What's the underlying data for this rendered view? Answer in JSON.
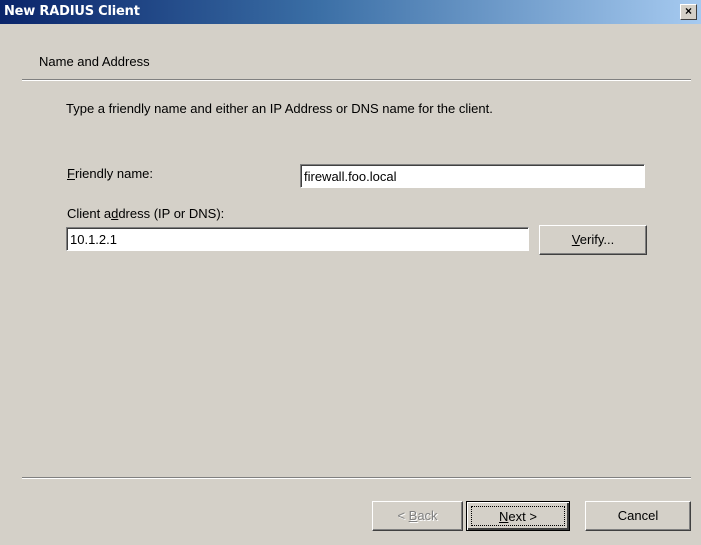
{
  "window": {
    "title": "New RADIUS Client",
    "close_glyph": "×"
  },
  "header": {
    "label": "Name and Address"
  },
  "main": {
    "instruction": "Type a friendly name and either an IP Address or DNS name for the client.",
    "friendly_name": {
      "label_mnemonic": "F",
      "label_rest": "riendly name:",
      "value": "firewall.foo.local"
    },
    "client_address": {
      "label_before": "Client a",
      "label_mnemonic": "d",
      "label_after": "dress (IP or DNS):",
      "value": "10.1.2.1"
    },
    "verify_button": {
      "mnemonic": "V",
      "rest": "erify..."
    }
  },
  "footer": {
    "back": {
      "prefix": "< ",
      "mnemonic": "B",
      "rest": "ack"
    },
    "next": {
      "mnemonic": "N",
      "rest": "ext >"
    },
    "cancel": "Cancel"
  },
  "colors": {
    "titlebar_start": "#0a246a",
    "titlebar_end": "#a6caf0",
    "dialog_face": "#d4d0c8"
  }
}
